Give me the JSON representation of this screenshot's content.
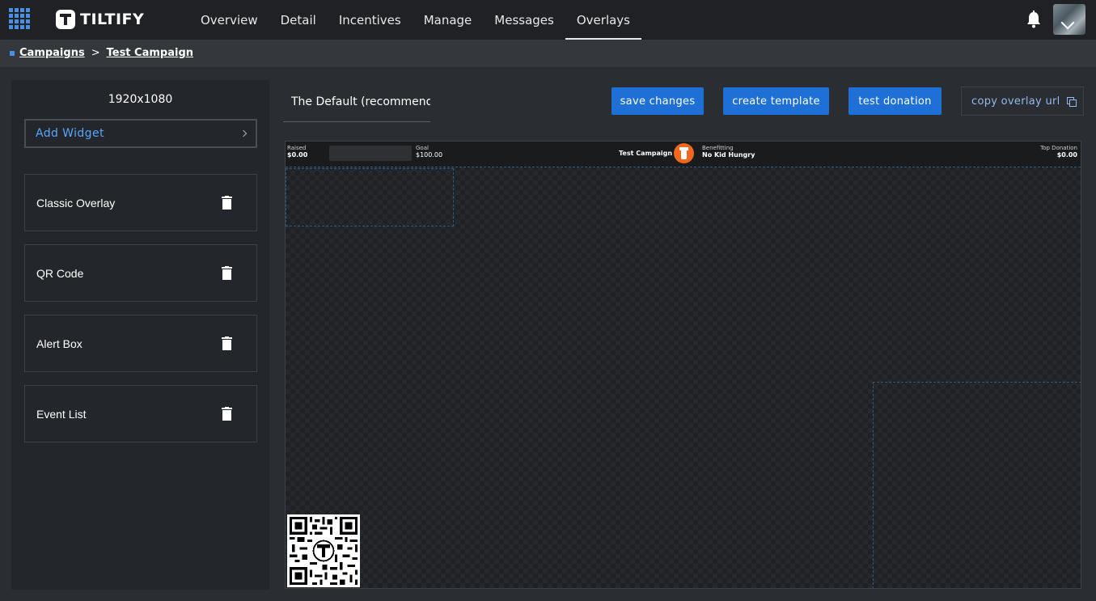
{
  "brand": {
    "name": "TILTIFY"
  },
  "nav": {
    "tabs": [
      {
        "label": "Overview"
      },
      {
        "label": "Detail"
      },
      {
        "label": "Incentives"
      },
      {
        "label": "Manage"
      },
      {
        "label": "Messages"
      },
      {
        "label": "Overlays",
        "active": true
      }
    ]
  },
  "breadcrumb": {
    "items": [
      "Campaigns",
      "Test Campaign"
    ],
    "separator": ">"
  },
  "sidebar": {
    "resolution": "1920x1080",
    "add_widget_label": "Add Widget",
    "widgets": [
      {
        "label": "Classic Overlay"
      },
      {
        "label": "QR Code"
      },
      {
        "label": "Alert Box"
      },
      {
        "label": "Event List"
      }
    ]
  },
  "toolbar": {
    "template_name": "The Default (recommended)",
    "save_label": "save changes",
    "create_template_label": "create template",
    "test_donation_label": "test donation",
    "copy_url_label": "copy overlay url"
  },
  "overlay": {
    "raised_label": "Raised",
    "raised_value": "$0.00",
    "goal_label": "Goal",
    "goal_value": "$100.00",
    "campaign_name": "Test Campaign",
    "benefitting_label": "Benefitting",
    "benefitting_value": "No Kid Hungry",
    "top_donation_label": "Top Donation",
    "top_donation_value": "$0.00",
    "progress": 0
  },
  "colors": {
    "accent": "#1e6fd6",
    "link": "#58a6ff",
    "nav_bg": "#1f2124",
    "brand_orange": "#f0671d"
  },
  "icons": [
    "apps-grid-icon",
    "tiltify-logo-icon",
    "bell-icon",
    "chevron-down-icon",
    "chevron-right-icon",
    "trash-icon",
    "copy-icon",
    "qr-code-icon"
  ]
}
